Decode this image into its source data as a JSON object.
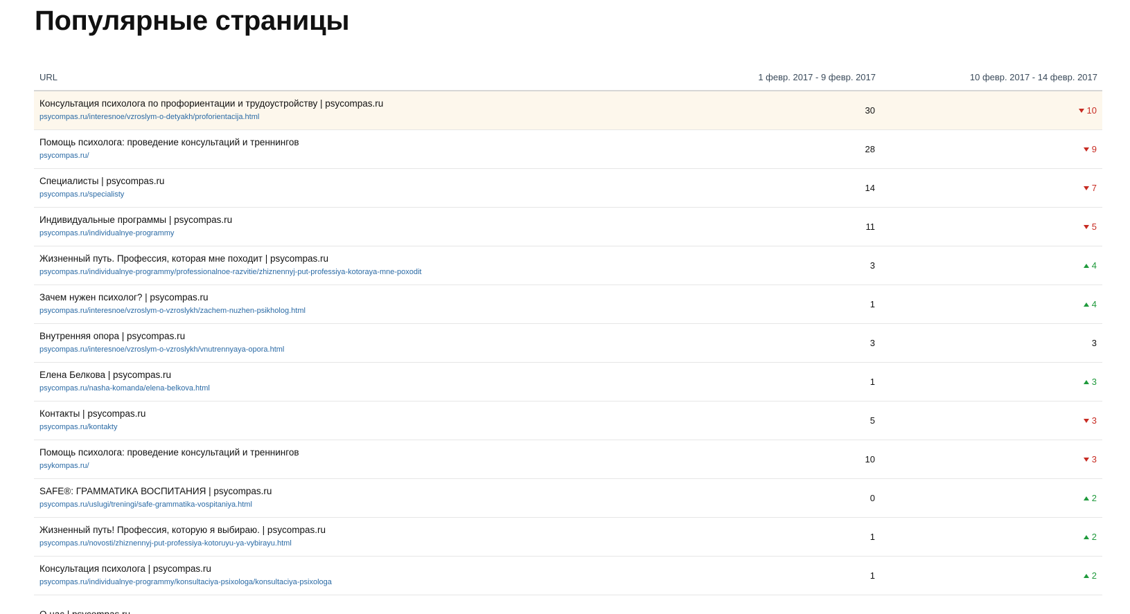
{
  "page": {
    "title": "Популярные страницы"
  },
  "table": {
    "columns": {
      "url": "URL",
      "period1": "1 февр. 2017 - 9 февр. 2017",
      "period2": "10 февр. 2017 - 14 февр. 2017"
    },
    "rows": [
      {
        "title": "Консультация психолога по профориентации и трудоустройству | psycompas.ru",
        "url": "psycompas.ru/interesnoe/vzroslym-o-detyakh/proforientacija.html",
        "period1": "30",
        "period2": "10",
        "trend": "down",
        "highlighted": true
      },
      {
        "title": "Помощь психолога: проведение консультаций и треннингов",
        "url": "psycompas.ru/",
        "period1": "28",
        "period2": "9",
        "trend": "down"
      },
      {
        "title": "Специалисты | psycompas.ru",
        "url": "psycompas.ru/specialisty",
        "period1": "14",
        "period2": "7",
        "trend": "down"
      },
      {
        "title": "Индивидуальные программы | psycompas.ru",
        "url": "psycompas.ru/individualnye-programmy",
        "period1": "11",
        "period2": "5",
        "trend": "down"
      },
      {
        "title": "Жизненный путь. Профессия, которая мне походит | psycompas.ru",
        "url": "psycompas.ru/individualnye-programmy/professionalnoe-razvitie/zhiznennyj-put-professiya-kotoraya-mne-poxodit",
        "period1": "3",
        "period2": "4",
        "trend": "up"
      },
      {
        "title": "Зачем нужен психолог? | psycompas.ru",
        "url": "psycompas.ru/interesnoe/vzroslym-o-vzroslykh/zachem-nuzhen-psikholog.html",
        "period1": "1",
        "period2": "4",
        "trend": "up"
      },
      {
        "title": "Внутренняя опора | psycompas.ru",
        "url": "psycompas.ru/interesnoe/vzroslym-o-vzroslykh/vnutrennyaya-opora.html",
        "period1": "3",
        "period2": "3",
        "trend": "none"
      },
      {
        "title": "Елена Белкова | psycompas.ru",
        "url": "psycompas.ru/nasha-komanda/elena-belkova.html",
        "period1": "1",
        "period2": "3",
        "trend": "up"
      },
      {
        "title": "Контакты | psycompas.ru",
        "url": "psycompas.ru/kontakty",
        "period1": "5",
        "period2": "3",
        "trend": "down"
      },
      {
        "title": "Помощь психолога: проведение консультаций и треннингов",
        "url": "psykompas.ru/",
        "period1": "10",
        "period2": "3",
        "trend": "down"
      },
      {
        "title": "SAFE®: ГРАММАТИКА ВОСПИТАНИЯ | psycompas.ru",
        "url": "psycompas.ru/uslugi/treningi/safe-grammatika-vospitaniya.html",
        "period1": "0",
        "period2": "2",
        "trend": "up"
      },
      {
        "title": "Жизненный путь! Профессия, которую я выбираю. | psycompas.ru",
        "url": "psycompas.ru/novosti/zhiznennyj-put-professiya-kotoruyu-ya-vybirayu.html",
        "period1": "1",
        "period2": "2",
        "trend": "up"
      },
      {
        "title": "Консультация психолога | psycompas.ru",
        "url": "psycompas.ru/individualnye-programmy/konsultaciya-psixologa/konsultaciya-psixologa",
        "period1": "1",
        "period2": "2",
        "trend": "up"
      },
      {
        "title": "О нас | psycompas.ru",
        "url": "",
        "period1": "",
        "period2": "",
        "trend": "none"
      }
    ]
  },
  "colors": {
    "down": "#c72b22",
    "up": "#1f9a3c",
    "link": "#2a6aa5",
    "highlight_row": "#fdf7ec"
  },
  "icons": {
    "down": "caret-down-icon",
    "up": "caret-up-icon"
  }
}
